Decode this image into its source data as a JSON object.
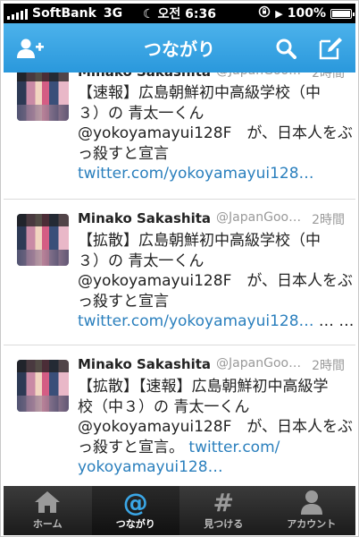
{
  "status_bar": {
    "carrier": "SoftBank",
    "network": "3G",
    "time": "오전 6:36",
    "battery": "100%",
    "battery_level": 1.0
  },
  "nav": {
    "title": "つながり",
    "left_icon": "add-user-icon",
    "search_icon": "search-icon",
    "compose_icon": "compose-icon"
  },
  "tweets": [
    {
      "name": "Minako Sakashita",
      "handle": "@JapanGoo…",
      "time": "2時間",
      "lines": [
        "【速報】広島朝鮮初中高級学校（中",
        "３）の 青太一くん",
        "@yokoyamayui128F　が、日本人をぶ",
        "っ殺すと宣言"
      ],
      "link": "twitter.com/yokoyamayui128…",
      "link_suffix": ""
    },
    {
      "name": "Minako Sakashita",
      "handle": "@JapanGoo…",
      "time": "2時間",
      "lines": [
        "【拡散】広島朝鮮初中高級学校（中",
        "３）の 青太一くん",
        "@yokoyamayui128F　が、日本人をぶ",
        "っ殺すと宣言"
      ],
      "link": "twitter.com/yokoyamayui128…",
      "link_suffix": " … …"
    },
    {
      "name": "Minako Sakashita",
      "handle": "@JapanGoo…",
      "time": "2時間",
      "lines": [
        "【拡散】【速報】広島朝鮮初中高級学",
        "校（中３）の 青太一くん",
        "@yokoyamayui128F　が、日本人をぶ"
      ],
      "line4_text": "っ殺すと宣言。",
      "line4_link": " twitter.com/",
      "link": "yokoyamayui128…"
    }
  ],
  "tabs": [
    {
      "label": "ホーム",
      "icon": "home-icon"
    },
    {
      "label": "つながり",
      "icon": "at-icon"
    },
    {
      "label": "見つける",
      "icon": "hash-icon"
    },
    {
      "label": "アカウント",
      "icon": "person-icon"
    }
  ],
  "colors": {
    "nav_blue": "#2a98dc",
    "link_blue": "#2a7fbd",
    "active_tab": "#3aa6e6"
  }
}
